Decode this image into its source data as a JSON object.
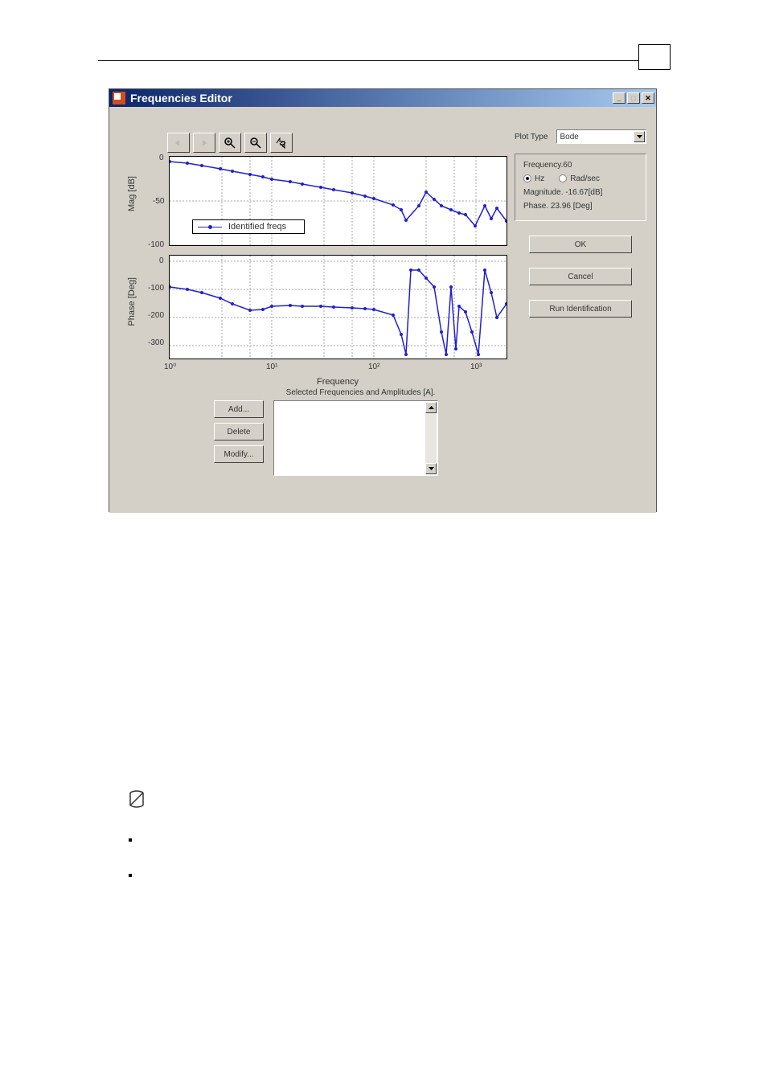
{
  "window": {
    "title": "Frequencies Editor"
  },
  "toolbar": {
    "zoom_in": "zoom-in",
    "zoom_out": "zoom-out",
    "help": "help"
  },
  "side": {
    "plot_type_label": "Plot Type",
    "plot_type_value": "Bode",
    "freq_label": "Frequency",
    "freq_value": "60",
    "unit_hz": "Hz",
    "unit_radsec": "Rad/sec",
    "magnitude_line": "Magnitude. -16.67[dB]",
    "phase_line": "Phase. 23.96 [Deg]",
    "ok": "OK",
    "cancel": "Cancel",
    "run": "Run Identification"
  },
  "chart": {
    "mag_label": "Mag [dB]",
    "phase_label": "Phase [Deg]",
    "x_label": "Frequency",
    "legend": "Identified freqs",
    "mag_ticks": [
      "0",
      "-50",
      "-100"
    ],
    "phase_ticks": [
      "0",
      "-100",
      "-200",
      "-300"
    ],
    "x_ticks": [
      "10⁰",
      "10¹",
      "10²",
      "10³"
    ]
  },
  "bottom": {
    "title": "Selected Frequencies and Amplitudes [A].",
    "add": "Add...",
    "del": "Delete",
    "modify": "Modify..."
  },
  "chart_data": [
    {
      "type": "line",
      "title": "",
      "legend_position": "inside-left",
      "series": [
        {
          "name": "Identified freqs",
          "x": [
            1,
            1.5,
            2,
            3,
            4,
            6,
            8,
            10,
            15,
            20,
            30,
            40,
            60,
            80,
            100,
            150,
            180,
            200,
            250,
            300,
            350,
            400,
            500,
            600,
            700,
            800,
            1000,
            1200,
            1500,
            2000
          ],
          "values": [
            -5,
            -7,
            -10,
            -13,
            -16,
            -20,
            -22,
            -25,
            -28,
            -30,
            -34,
            -37,
            -41,
            -44,
            -47,
            -54,
            -60,
            -72,
            -55,
            -40,
            -48,
            -55,
            -60,
            -63,
            -65,
            -78,
            -55,
            -70,
            -58,
            -73
          ]
        }
      ],
      "xlabel": "Frequency",
      "ylabel": "Mag [dB]",
      "xscale": "log",
      "xlim": [
        1,
        2000
      ],
      "ylim": [
        -100,
        0
      ],
      "grid": true
    },
    {
      "type": "line",
      "series": [
        {
          "name": "Identified freqs",
          "x": [
            1,
            1.5,
            2,
            3,
            4,
            6,
            8,
            10,
            15,
            20,
            30,
            40,
            60,
            80,
            100,
            150,
            180,
            200,
            220,
            250,
            300,
            350,
            400,
            450,
            500,
            550,
            600,
            700,
            800,
            900,
            1000,
            1200,
            1500,
            2000
          ],
          "values": [
            -90,
            -100,
            -110,
            -130,
            -150,
            -175,
            -170,
            -160,
            -157,
            -158,
            -160,
            -163,
            -165,
            -168,
            -170,
            -190,
            -260,
            -330,
            -30,
            -30,
            -60,
            -90,
            -250,
            -330,
            -90,
            -310,
            -160,
            -180,
            -250,
            -330,
            -30,
            -110,
            -200,
            -150
          ]
        }
      ],
      "xlabel": "Frequency",
      "ylabel": "Phase [Deg]",
      "xscale": "log",
      "xlim": [
        1,
        2000
      ],
      "ylim": [
        -350,
        20
      ],
      "grid": true
    }
  ]
}
